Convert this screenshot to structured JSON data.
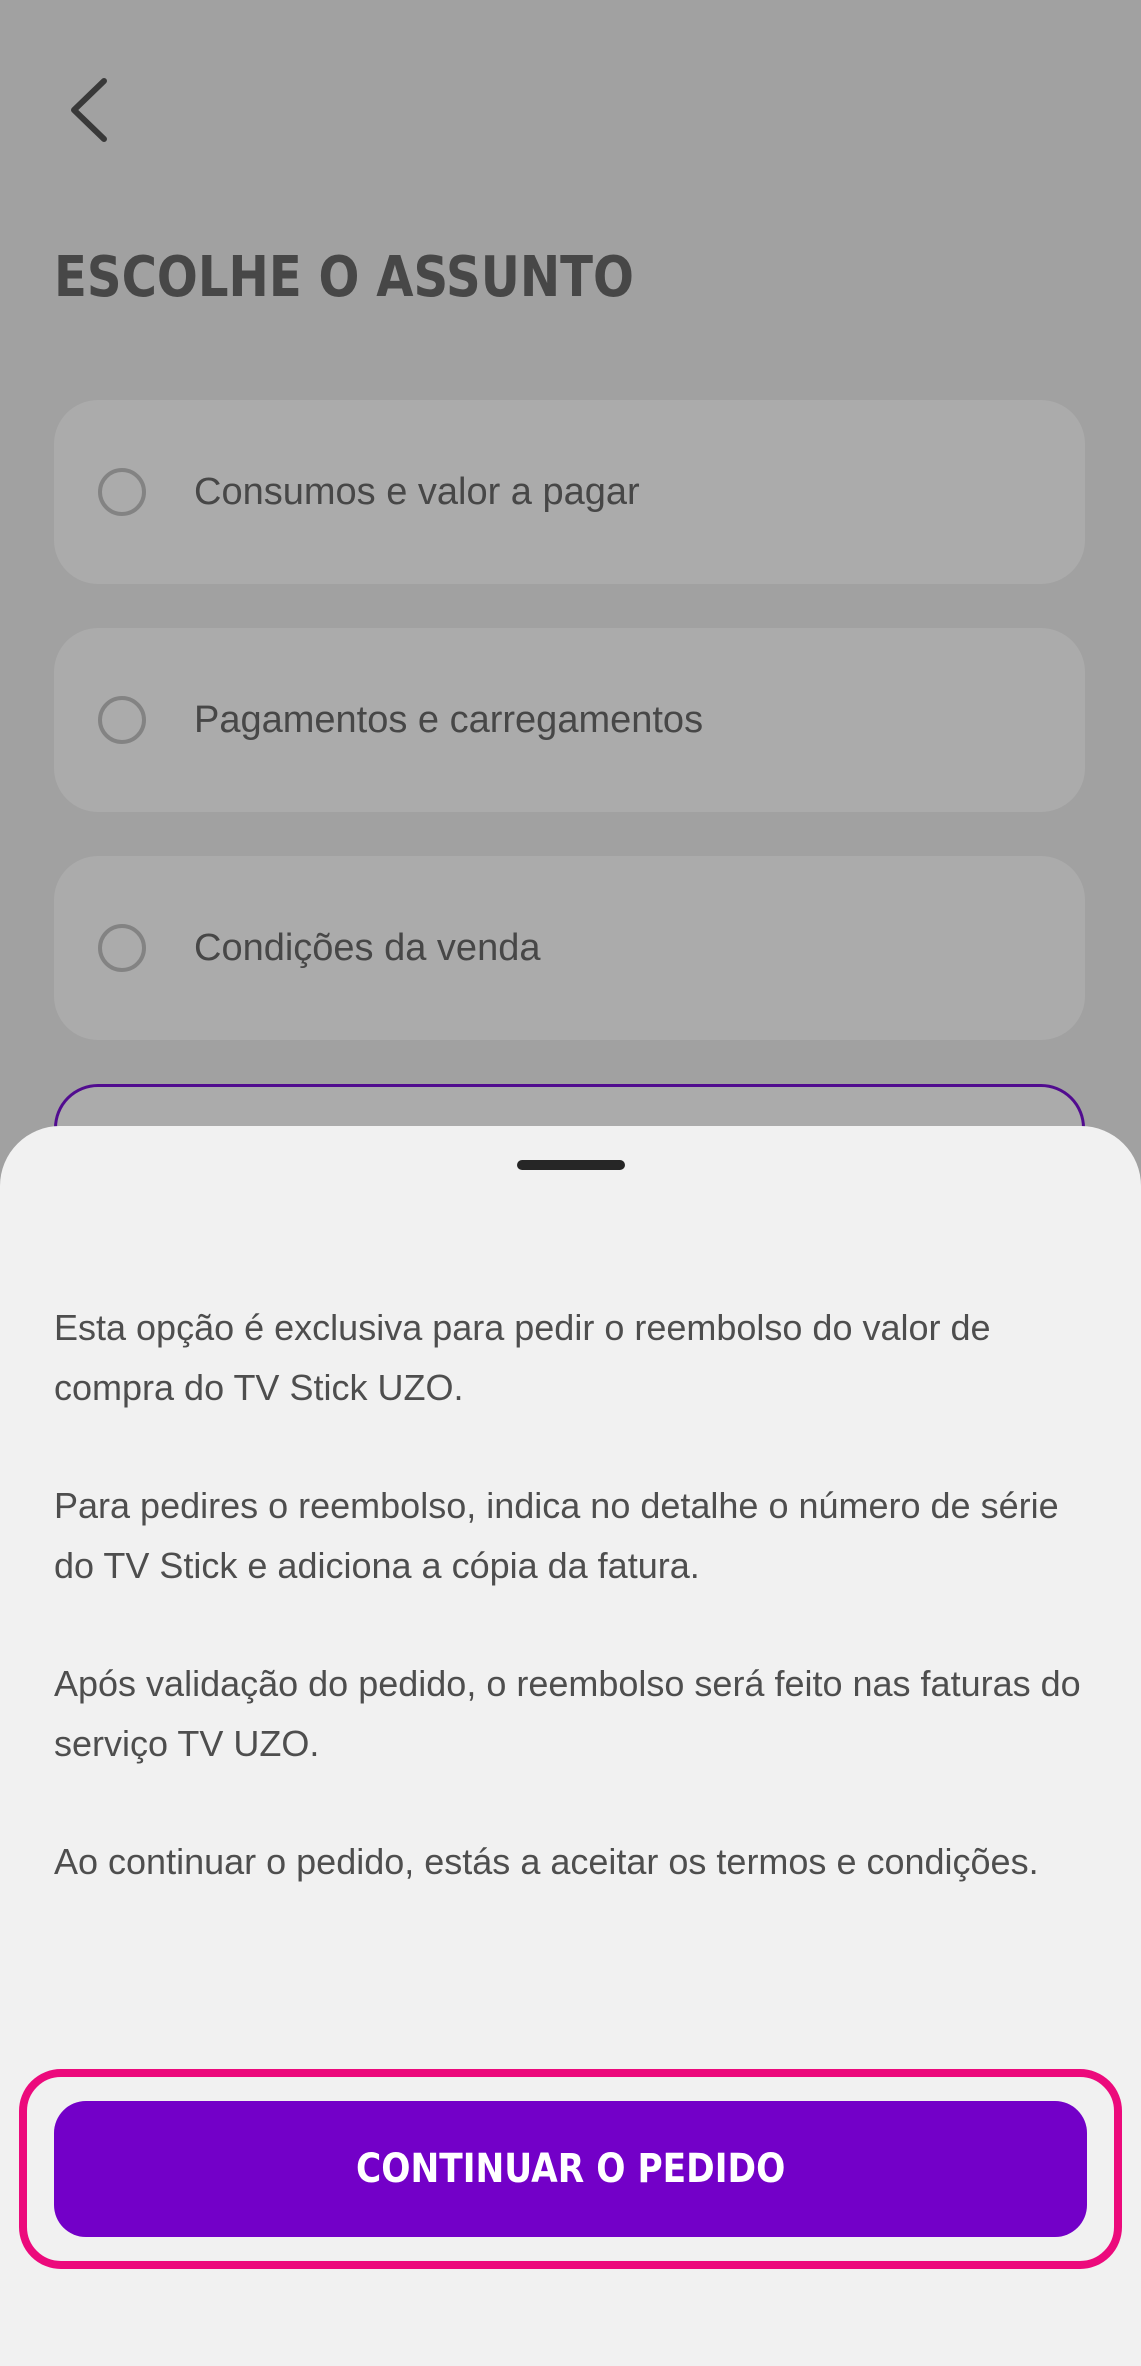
{
  "header": {
    "back_icon": "chevron-left-icon",
    "title": "ESCOLHE O ASSUNTO"
  },
  "options": [
    {
      "label": "Consumos e valor a pagar",
      "selected": false
    },
    {
      "label": "Pagamentos e carregamentos",
      "selected": false
    },
    {
      "label": "Condições da venda",
      "selected": false
    },
    {
      "label": "",
      "selected": true
    }
  ],
  "sheet": {
    "paragraphs": [
      "Esta opção é exclusiva para pedir o reembolso do valor de compra do TV Stick UZO.",
      "Para pedires o reembolso, indica no detalhe o número de série do TV Stick e adiciona a cópia da fatura.",
      "Após validação do pedido, o reembolso será feito nas faturas do serviço TV UZO.",
      "Ao continuar o pedido, estás a aceitar os termos e condições."
    ],
    "continue_label": "CONTINUAR O PEDIDO"
  },
  "colors": {
    "accent": "#7300c8",
    "highlight_ring": "#ec0a7c",
    "selected_border": "#7a12d6"
  }
}
